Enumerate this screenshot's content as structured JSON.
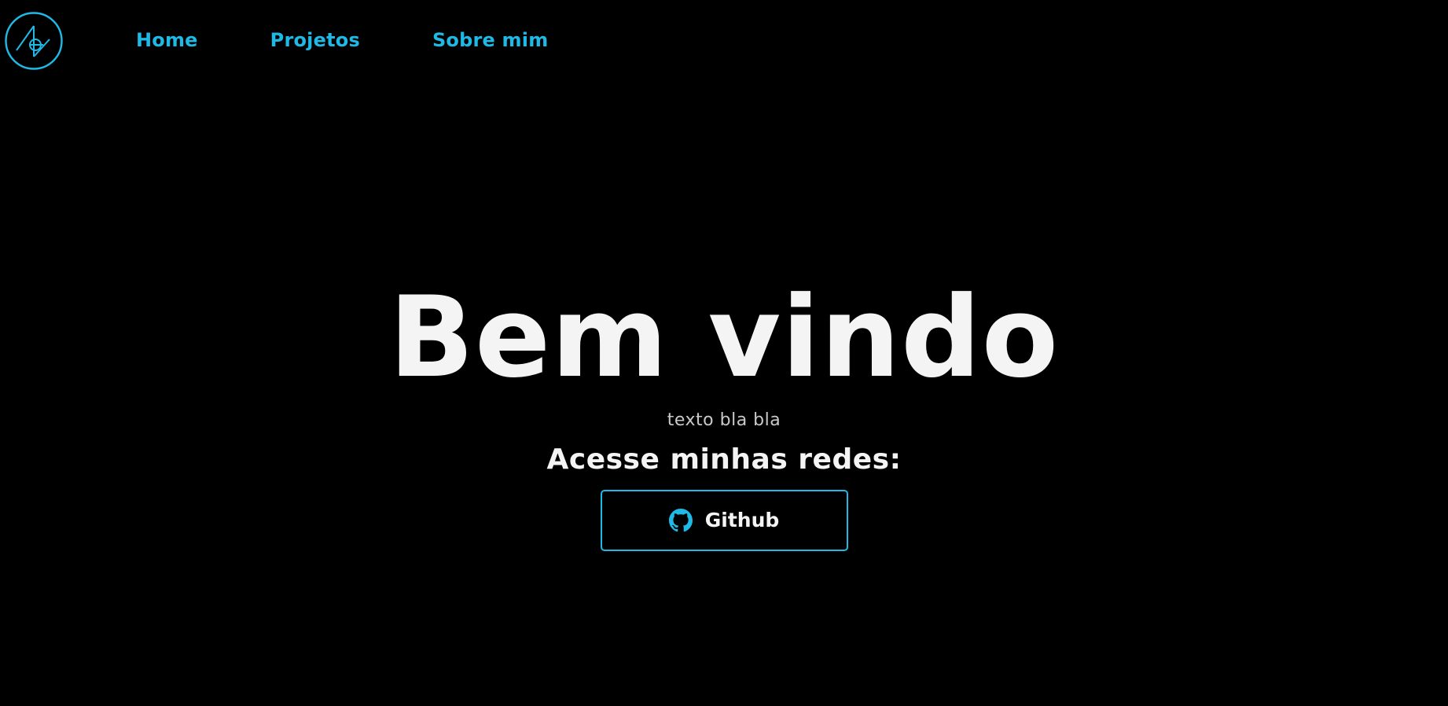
{
  "theme": {
    "background": "#000000",
    "accent": "#1fb9e6",
    "text_primary": "#f4f4f4",
    "text_secondary": "#c9c9c9"
  },
  "header": {
    "logo_icon": "circle-monogram-logo-icon",
    "nav": [
      {
        "label": "Home"
      },
      {
        "label": "Projetos"
      },
      {
        "label": "Sobre mim"
      }
    ]
  },
  "hero": {
    "title": "Bem vindo",
    "subtitle": "texto bla bla",
    "socials_heading": "Acesse minhas redes:",
    "github_button": {
      "icon": "github-icon",
      "label": "Github"
    }
  }
}
